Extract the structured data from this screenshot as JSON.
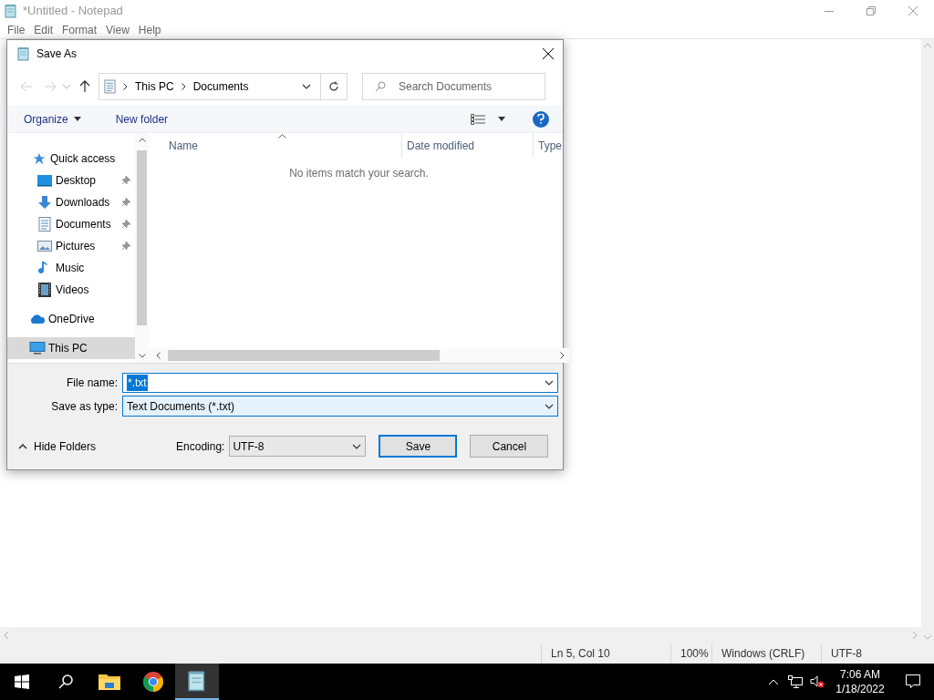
{
  "notepad": {
    "title": "*Untitled - Notepad",
    "menu": [
      "File",
      "Edit",
      "Format",
      "View",
      "Help"
    ],
    "status_bar": [
      "Ln 5, Col 10",
      "100%",
      "Windows (CRLF)",
      "UTF-8"
    ]
  },
  "dialog": {
    "title": "Save As",
    "address": {
      "path": [
        "This PC",
        "Documents"
      ]
    },
    "search": {
      "placeholder": "Search Documents"
    },
    "toolbar": [
      {
        "label": "Organize",
        "menu": true
      },
      {
        "label": "New folder",
        "menu": false
      }
    ],
    "nav": [
      {
        "label": "Quick access",
        "kind": "star",
        "selected": false,
        "children": [
          {
            "label": "Desktop",
            "kind": "desktop",
            "pinned": true,
            "selected": false
          },
          {
            "label": "Downloads",
            "kind": "download",
            "pinned": true,
            "selected": false
          },
          {
            "label": "Documents",
            "kind": "document",
            "pinned": true,
            "selected": false
          },
          {
            "label": "Pictures",
            "kind": "pictures",
            "pinned": true,
            "selected": false
          },
          {
            "label": "Music",
            "kind": "music",
            "pinned": false,
            "selected": false
          },
          {
            "label": "Videos",
            "kind": "videos",
            "pinned": false,
            "selected": false
          }
        ]
      },
      {
        "label": "OneDrive",
        "kind": "cloud",
        "selected": false
      },
      {
        "label": "This PC",
        "kind": "pc",
        "selected": true
      }
    ],
    "columns": [
      "Name",
      "Date modified",
      "Type"
    ],
    "empty_message": "No items match your search.",
    "file_name": {
      "label": "File name:",
      "value": "*.txt",
      "value_selected": true
    },
    "save_as_type": {
      "label": "Save as type:",
      "value": "Text Documents (*.txt)"
    },
    "hide_folders": "Hide Folders",
    "encoding": {
      "label": "Encoding:",
      "value": "UTF-8"
    },
    "buttons": [
      {
        "label": "Save",
        "default": true
      },
      {
        "label": "Cancel",
        "default": false
      }
    ]
  },
  "taskbar": {
    "apps": [
      {
        "kind": "explorer",
        "selected": false
      },
      {
        "kind": "chrome",
        "selected": false
      },
      {
        "kind": "notepad",
        "selected": true
      }
    ],
    "time": "7:06 AM",
    "date": "1/18/2022"
  }
}
